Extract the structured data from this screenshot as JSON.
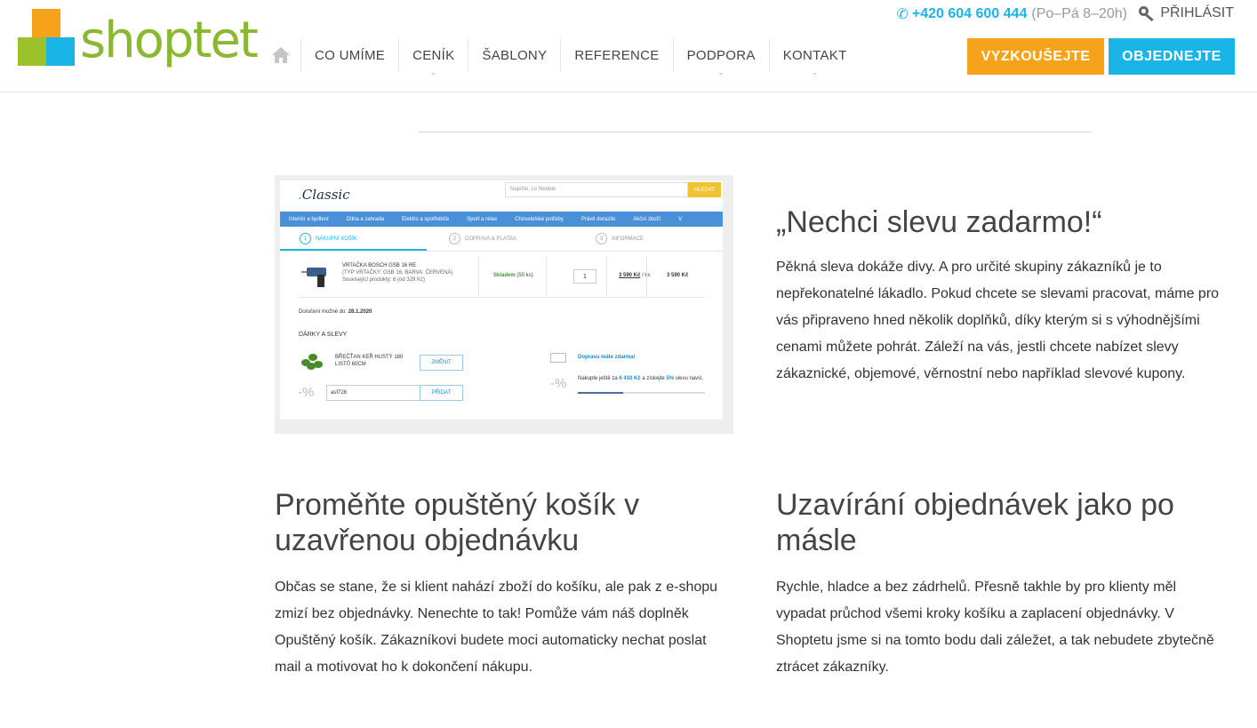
{
  "brand": {
    "logo_text": "shoptet",
    "colors": {
      "orange": "#f7a21b",
      "green": "#9dc12a",
      "blue": "#1ab4e6"
    }
  },
  "header": {
    "phone": "+420 604 600 444",
    "hours": "(Po–Pá 8–20h)",
    "login": "PŘIHLÁSIT",
    "nav": [
      "CO UMÍME",
      "CENÍK",
      "ŠABLONY",
      "REFERENCE",
      "PODPORA",
      "KONTAKT"
    ],
    "btn_try": "VYZKOUŠEJTE",
    "btn_order": "OBJEDNEJTE"
  },
  "screenshot": {
    "logo": "Classic",
    "search_placeholder": "Napište, co hledáte",
    "search_btn": "HLEDAT",
    "menu": [
      "Interiér a bydlení",
      "Dílna a zahrada",
      "Elektro a spotřebiče",
      "Sport a relax",
      "Chovatelské potřeby",
      "Právě dorazilo",
      "Akční zboží",
      "V"
    ],
    "steps": [
      {
        "num": "1",
        "label": "NÁKUPNÍ KOŠÍK"
      },
      {
        "num": "2",
        "label": "DOPRAVA & PLATBA"
      },
      {
        "num": "3",
        "label": "INFORMACE"
      }
    ],
    "product": {
      "name": "VRTAČKA BOSCH GSB 16 RE",
      "variant": "(TYP VRTAČKY: GSB 16, BARVA: ČERVENÁ)",
      "related": "Související produkty: 6 (od 329 Kč)",
      "stock": "Skladem",
      "stock_count": "(50 ks)",
      "qty": "1",
      "unit_price": "3 590 Kč",
      "unit_suffix": "/ ks",
      "total": "3 590 Kč"
    },
    "delivery_label": "Doručení možné do:",
    "delivery_date": "28.1.2020",
    "gifts_heading": "DÁRKY A SLEVY",
    "gift_name_1": "BŘEČŤAN KEŘ HUSTÝ 180",
    "gift_name_2": "LISTŮ 60CM",
    "change_btn": "ZMĚNIT",
    "pct_symbol": "-%",
    "coupon_value": "asf728",
    "add_btn": "PŘIDAT",
    "free_shipping": "Dopravu máte zdarma!",
    "more_prefix": "Nakupte ještě za",
    "more_amount": "6 410 Kč",
    "more_mid": "a získejte",
    "more_pct": "5%",
    "more_suffix": "slevu navíc.",
    "progress": 0.36
  },
  "sections": [
    {
      "title": "„Nechci slevu zadarmo!“",
      "text": "Pěkná sleva dokáže divy. A pro určité skupiny zákazníků je to nepřekonatelné lákadlo. Pokud chcete se slevami pracovat, máme pro vás připraveno hned několik doplňků, díky kterým si s výhodnějšími cenami můžete pohrát. Záleží na vás, jestli chcete nabízet slevy zákaznické, objemové, věrnostní nebo například slevové kupony."
    },
    {
      "title": "Proměňte opuštěný košík v uzavřenou objednávku",
      "text": "Občas se stane, že si klient  nahází zboží do košíku, ale pak z e-shopu zmizí bez objednávky. Nenechte to tak! Pomůže vám náš doplněk Opuštěný košík. Zákazníkovi budete moci automaticky nechat poslat mail a motivovat ho k dokončení nákupu."
    },
    {
      "title": "Uzavírání objednávek jako po másle",
      "text": "Rychle, hladce a bez zádrhelů. Přesně takhle by pro klienty měl vypadat průchod všemi kroky košíku a zaplacení objednávky. V Shoptetu jsme si na tomto bodu dali záležet, a tak nebudete zbytečně ztrácet zákazníky."
    }
  ]
}
